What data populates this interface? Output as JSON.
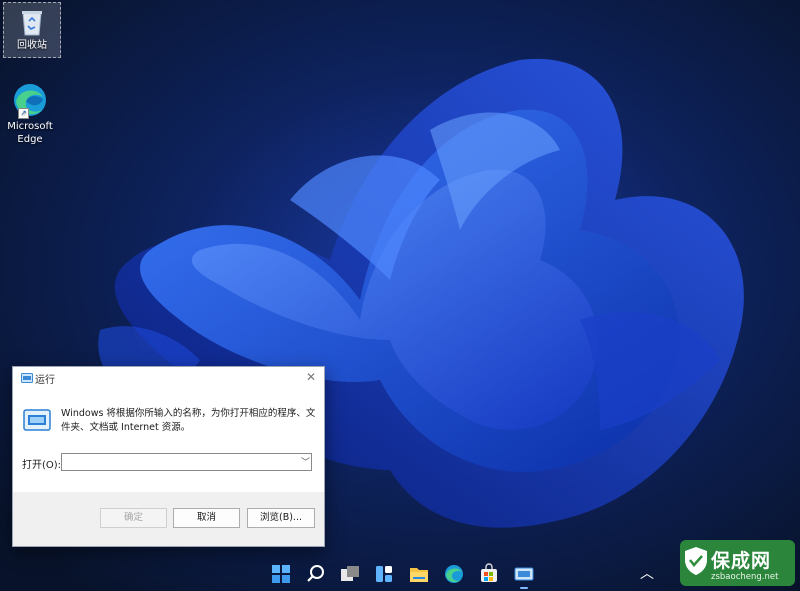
{
  "desktop": {
    "icons": [
      {
        "label": "回收站",
        "icon": "recycle-bin-icon"
      },
      {
        "label": "Microsoft Edge",
        "icon": "edge-icon"
      }
    ]
  },
  "run_dialog": {
    "title": "运行",
    "description": "Windows 将根据你所输入的名称，为你打开相应的程序、文件夹、文档或 Internet 资源。",
    "open_label": "打开(O):",
    "input_value": "",
    "buttons": {
      "ok": "确定",
      "cancel": "取消",
      "browse": "浏览(B)..."
    }
  },
  "taskbar": {
    "icons": [
      "start-icon",
      "search-icon",
      "task-view-icon",
      "widgets-icon",
      "file-explorer-icon",
      "edge-icon",
      "store-icon",
      "run-icon"
    ],
    "tray": [
      "chevron-up-icon"
    ]
  },
  "watermark": {
    "title": "保成网",
    "url": "zsbaocheng.net"
  },
  "colors": {
    "accent": "#1f5ee6",
    "wallpaper_dark": "#0b1730"
  }
}
